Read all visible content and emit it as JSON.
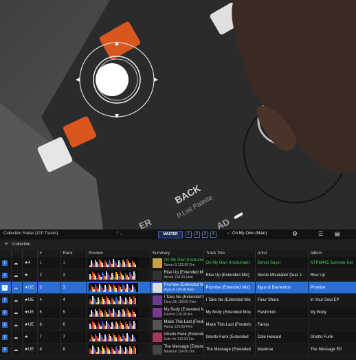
{
  "toolbar": {
    "panel_title": "Collection Radar (100 Tracks)",
    "master_label": "MASTER",
    "decks": [
      "1",
      "2",
      "3",
      "4"
    ],
    "now_playing": "On My Own (Main)"
  },
  "photo": {
    "hardware_labels": [
      "BACK",
      "P.List Palette",
      "ER",
      "AD"
    ]
  },
  "collection": {
    "label": "Collection"
  },
  "columns": [
    "",
    "",
    "",
    "#",
    "Rank",
    "Preview",
    "Summary",
    "Track Title",
    "Artist",
    "Album"
  ],
  "colors": {
    "accent": "#2a6fd6",
    "playing": "#35d64a",
    "waveform": [
      "#f0a020",
      "#e0e0e0",
      "#4060d0",
      "#c03030"
    ]
  },
  "tracks": [
    {
      "num": "1",
      "rank": "1",
      "sum_title": "On My Own (Instrument",
      "sum_meta": "Simon S  125.00  Dm",
      "title": "On My Own (Instrument",
      "artist": "Simon Says!",
      "album": "NTPM445 Summer Ser",
      "key": "4",
      "playing": true,
      "selected": false
    },
    {
      "num": "2",
      "rank": "2",
      "sum_title": "Rise Up (Extended Mix)",
      "sum_meta": "Nicole   128.00  Ebm",
      "title": "Rise Up (Extended Mix)",
      "artist": "Nicole Mcudaber (feat. L",
      "album": "Rise Up",
      "key": "",
      "playing": false,
      "selected": false
    },
    {
      "num": "3",
      "rank": "3",
      "sum_title": "Promise (Extended Mix)",
      "sum_meta": "Illyus &  124.00  Abm",
      "title": "Promise (Extended Mix)",
      "artist": "Illyus & Barrientos",
      "album": "Promise",
      "key": "UE",
      "playing": false,
      "selected": true
    },
    {
      "num": "4",
      "rank": "4",
      "sum_title": "I Take No (Extended Mix",
      "sum_meta": "Fleur Sh  128.00  F#m",
      "title": "I Take No (Extended Mix",
      "artist": "Fleur Shore",
      "album": "In Your Soul EP",
      "key": "UE",
      "playing": false,
      "selected": false
    },
    {
      "num": "5",
      "rank": "5",
      "sum_title": "My Body (Extended Mix)",
      "sum_meta": "Flashm   128.00  Am",
      "title": "My Body (Extended Mix)",
      "artist": "Flashmob",
      "album": "My Body",
      "key": "UE",
      "playing": false,
      "selected": false
    },
    {
      "num": "6",
      "rank": "6",
      "sum_title": "Make This Last (Frederic",
      "sum_meta": "Farius   125.00  F#m",
      "title": "Make This Last (Frederic",
      "artist": "Farius",
      "album": "",
      "key": "UE",
      "playing": false,
      "selected": false
    },
    {
      "num": "7",
      "rank": "7",
      "sum_title": "Ghetto Funk (Extended",
      "sum_meta": "Dale Ho  120.00  Fm",
      "title": "Ghetto Funk (Extended",
      "artist": "Dale Howard",
      "album": "Ghetto Funk",
      "key": "",
      "playing": false,
      "selected": false
    },
    {
      "num": "8",
      "rank": "8",
      "sum_title": "The Message (Extended M",
      "sum_meta": "Maxinne  124.00  Dm",
      "title": "The Message (Extended",
      "artist": "Maxinne",
      "album": "The Message EP",
      "key": "UE",
      "playing": false,
      "selected": false
    }
  ]
}
